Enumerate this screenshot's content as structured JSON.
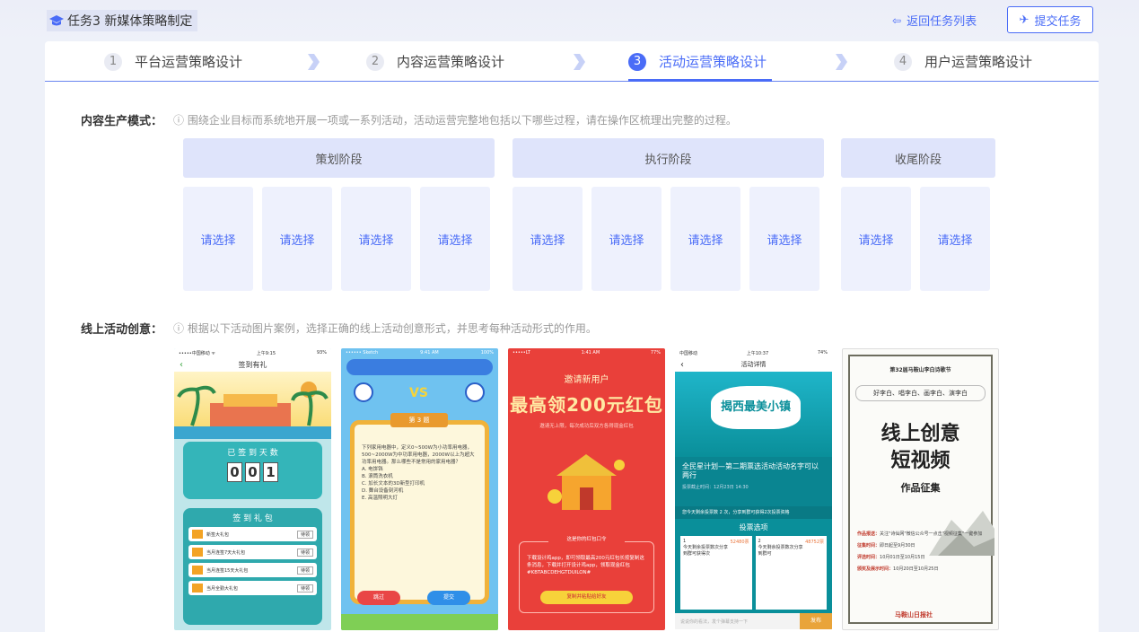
{
  "header": {
    "task_title": "任务3 新媒体策略制定",
    "back_label": "返回任务列表",
    "submit_label": "提交任务"
  },
  "steps": [
    {
      "num": "1",
      "label": "平台运营策略设计"
    },
    {
      "num": "2",
      "label": "内容运营策略设计"
    },
    {
      "num": "3",
      "label": "活动运营策略设计",
      "active": true
    },
    {
      "num": "4",
      "label": "用户运营策略设计"
    }
  ],
  "content_mode": {
    "label": "内容生产模式：",
    "hint": "ⓘ 围绕企业目标而系统地开展一项或一系列活动，活动运营完整地包括以下哪些过程，请在操作区梳理出完整的过程。",
    "phases": [
      "策划阶段",
      "执行阶段",
      "收尾阶段"
    ],
    "slot_label": "请选择"
  },
  "online_ideas": {
    "label": "线上活动创意：",
    "hint": "ⓘ 根据以下活动图片案例，选择正确的线上活动创意形式，并思考每种活动形式的作用。"
  },
  "cards": {
    "c1": {
      "status_left": "•••••中国移动 ᯤ",
      "status_mid": "上午9:15",
      "status_right": "93%",
      "nav_title": "签到有礼",
      "days_title": "已 签 到 天 数",
      "digits": [
        "0",
        "0",
        "1"
      ],
      "gift_title": "签 到 礼 包",
      "rows": [
        "新签大礼包",
        "当月连签7天大礼包",
        "当月连签15天大礼包",
        "当月全勤大礼包"
      ],
      "row_btn": "待领"
    },
    "c2": {
      "status_left": "•••••• Sketch",
      "status_mid": "9:41 AM",
      "status_right": "100%",
      "vs": "VS",
      "round": "第 3 题",
      "question": "下列家用电器中，定义0~500W为小功率用电器，500~2000W为中功率用电器，2000W以上为超大功率用电器。那么哪些不是常用的家用电器？",
      "options": [
        "A. 电饼铛",
        "B. 滚筒洗衣机",
        "C. 加长文本的3D新型打印机",
        "D. 舞台设备刻河机",
        "E. 高温照明大灯"
      ],
      "btn_left": "跳过",
      "btn_right": "提交"
    },
    "c3": {
      "status_left": "•••••LT",
      "status_mid": "1:41 AM",
      "status_right": "77%",
      "t1": "邀请新用户",
      "t2": "最高领200元红包",
      "t3": "邀请无上限，每次成功后双方各得现金红包",
      "code_title": "这是你的红包口令",
      "code_text": "下载设计鸡app，即可领取最高200元红包长按复制这条消息，下载并打开设计鸡app，领取现金红包#KBTABCDEHGTDUILON#",
      "copy_btn": "复制并粘贴给好友"
    },
    "c4": {
      "status_left": "中国移动",
      "status_mid": "上午10:37",
      "status_right": "74%",
      "nav_title": "活动详情",
      "logo": "揭西最美小镇",
      "info_title": "全民星计划—第二期票选活动活动名字可以两行",
      "info_sub": "投票截止时间：12月23日 14:30",
      "strip": "您今天剩余投票数 2 次，分享到群可获得2次投票资格",
      "vote_title": "投票选项",
      "vote_cells": [
        {
          "rank": "1",
          "count": "52480票",
          "text": "今天剩余投票数次分享到群可获得次"
        },
        {
          "rank": "2",
          "count": "48752票",
          "text": "今天剩余投票数次分享到群可"
        }
      ],
      "foot_placeholder": "说说你的看法，发个弹幕支持一下",
      "foot_btn": "发布"
    },
    "c5": {
      "hd1": "第32届马鞍山李白诗歌节",
      "hd2": "好李白、唱李白、画李白、演李白",
      "big1": "线上创意",
      "big2": "短视频",
      "zp": "作品征集",
      "rules": [
        {
          "k": "作品报送：",
          "v": "关注\"诗仙网\"微信公众号一点击\"视频征集\"一键参加"
        },
        {
          "k": "征集时间：",
          "v": "即日起至9月30日"
        },
        {
          "k": "评选时间：",
          "v": "10月01日至10月15日"
        },
        {
          "k": "颁奖及展示时间：",
          "v": "10月20日至10月25日"
        }
      ],
      "seal": "马鞍山日报社"
    }
  }
}
